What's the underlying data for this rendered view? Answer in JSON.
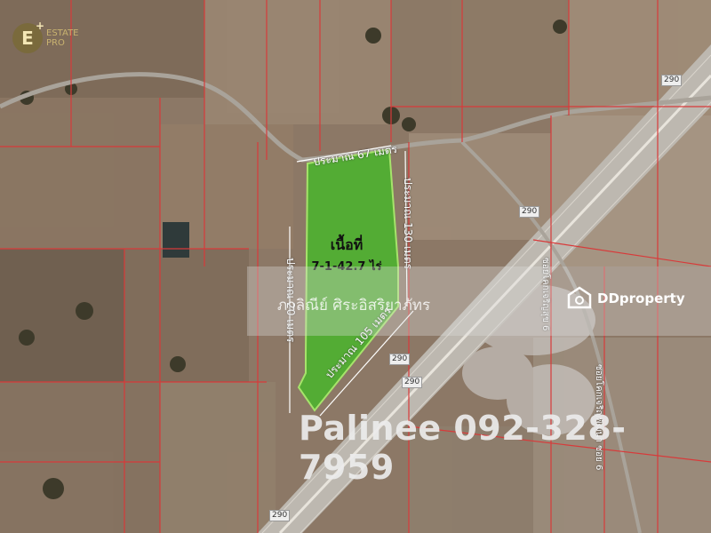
{
  "logo": {
    "mark": "E",
    "line1": "ESTATE",
    "line2": "PRO"
  },
  "parcel": {
    "area_title": "เนื้อที่",
    "area_value": "7-1-42.7 ไร่",
    "top_side": "ประมาณ 67 เมตร",
    "right_side": "ประมาณ 130 เมตร",
    "left_side": "ประมาณ 20 เมตร",
    "bottom_side": "ประมาณ 105 เมตร",
    "fill_color": "#49b52c"
  },
  "roads": {
    "highway_number": "290",
    "soi_label_1": "ซอยโคกเจริญสุข 6",
    "soi_label_2": "ซอยโคกเจริญพัฒนา ซอย 6"
  },
  "watermark": {
    "owner": "ภาลิณีย์ ศิระอิสริยาภัทร",
    "brand": "DDproperty",
    "phone": "Palinee 092-328-7959"
  },
  "colors": {
    "boundary": "#d83a3a",
    "road": "#c9c9c9"
  }
}
